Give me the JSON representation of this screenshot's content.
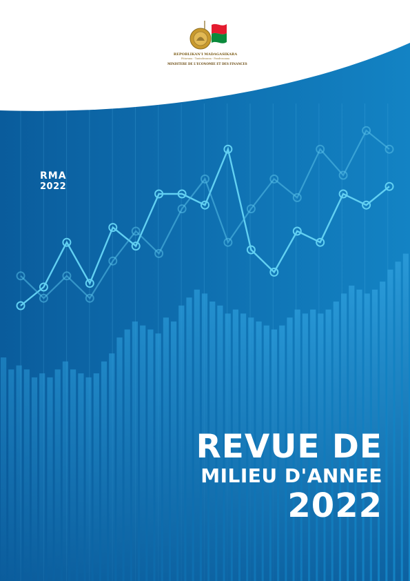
{
  "logo": {
    "country": "REPOBLIKAN'I MADAGASIKARA",
    "motto": "Fitiavana - Tanindrazana - Fandrosoana",
    "ministry": "MINISTERE DE L'ECONOMIE ET DES FINANCES",
    "flag_colors": {
      "white": "#ffffff",
      "red": "#e41b2f",
      "green": "#0a8a3c"
    },
    "seal_color": "#c99a2e"
  },
  "badge": {
    "code": "RMA",
    "year": "2022"
  },
  "title": {
    "line1": "REVUE DE",
    "line2": "MILIEU D'ANNEE",
    "year": "2022"
  },
  "colors": {
    "background": "#0b63a6",
    "bar": "#1a8ad0",
    "line": "#56c6ee",
    "wave": "#ffffff"
  },
  "chart_data": {
    "type": "bar",
    "bars": [
      56,
      53,
      54,
      53,
      51,
      52,
      51,
      53,
      55,
      53,
      52,
      51,
      52,
      55,
      57,
      61,
      63,
      65,
      64,
      63,
      62,
      66,
      65,
      69,
      71,
      73,
      72,
      70,
      69,
      67,
      68,
      67,
      66,
      65,
      64,
      63,
      64,
      66,
      68,
      67,
      68,
      67,
      68,
      70,
      72,
      74,
      73,
      72,
      73,
      75,
      78,
      80,
      82
    ],
    "series": [
      {
        "values": [
          55,
          60,
          72,
          61,
          76,
          71,
          85,
          85,
          82,
          97,
          70,
          64,
          75,
          72,
          85,
          82,
          87
        ]
      },
      {
        "values": [
          63,
          57,
          63,
          57,
          67,
          75,
          69,
          81,
          89,
          72,
          81,
          89,
          84,
          97,
          90,
          102,
          97
        ]
      }
    ]
  }
}
